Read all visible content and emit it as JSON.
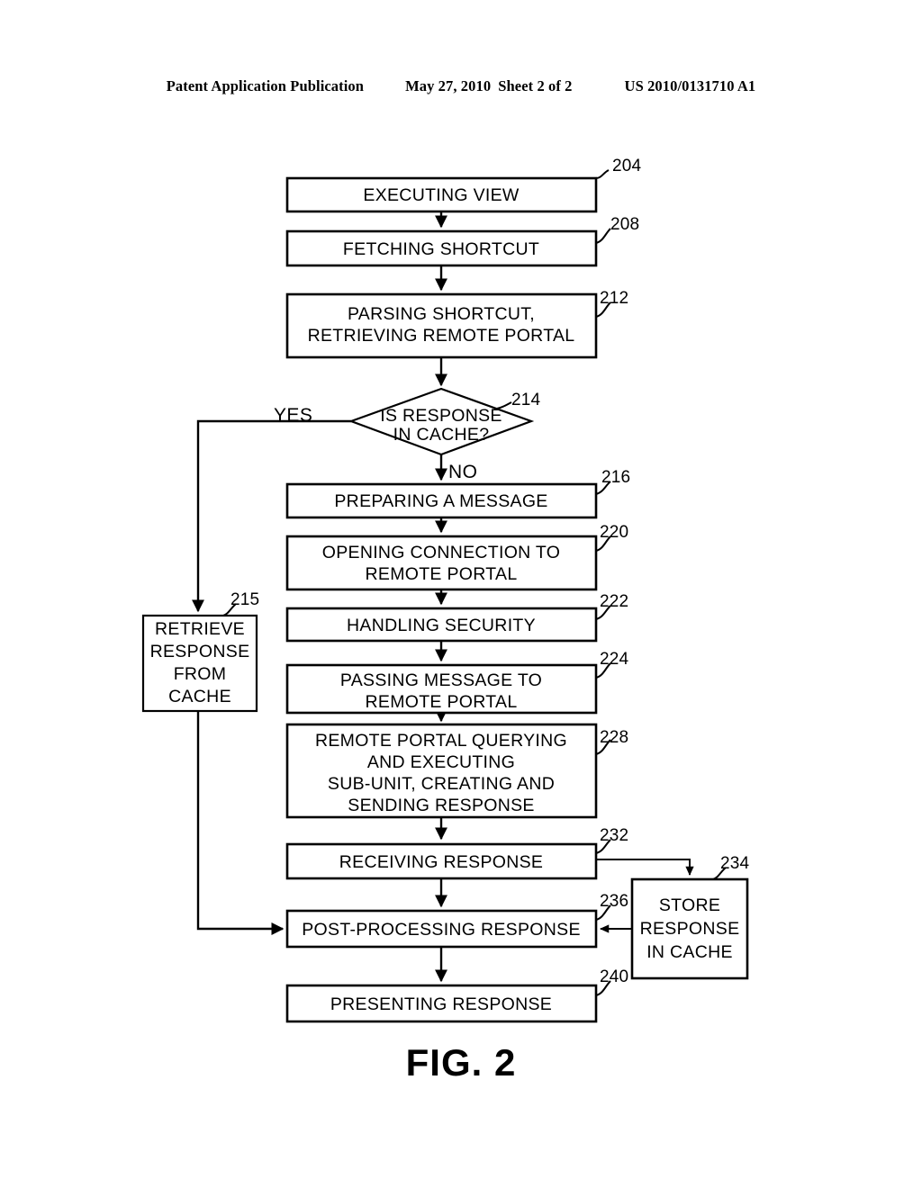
{
  "header": {
    "publication": "Patent Application Publication",
    "date": "May 27, 2010",
    "sheet": "Sheet 2 of 2",
    "number": "US 2010/0131710 A1"
  },
  "figure": {
    "caption": "FIG. 2"
  },
  "diagram": {
    "type": "flowchart",
    "edge_labels": {
      "yes": "YES",
      "no": "NO"
    },
    "nodes": [
      {
        "ref": "204",
        "shape": "process",
        "lines": [
          "EXECUTING VIEW"
        ]
      },
      {
        "ref": "208",
        "shape": "process",
        "lines": [
          "FETCHING SHORTCUT"
        ]
      },
      {
        "ref": "212",
        "shape": "process",
        "lines": [
          "PARSING SHORTCUT,",
          "RETRIEVING REMOTE PORTAL"
        ]
      },
      {
        "ref": "214",
        "shape": "decision",
        "lines": [
          "IS RESPONSE",
          "IN CACHE?"
        ]
      },
      {
        "ref": "215",
        "shape": "process",
        "lines": [
          "RETRIEVE",
          "RESPONSE",
          "FROM",
          "CACHE"
        ]
      },
      {
        "ref": "216",
        "shape": "process",
        "lines": [
          "PREPARING A MESSAGE"
        ]
      },
      {
        "ref": "220",
        "shape": "process",
        "lines": [
          "OPENING CONNECTION TO",
          "REMOTE PORTAL"
        ]
      },
      {
        "ref": "222",
        "shape": "process",
        "lines": [
          "HANDLING SECURITY"
        ]
      },
      {
        "ref": "224",
        "shape": "process",
        "lines": [
          "PASSING MESSAGE TO",
          "REMOTE PORTAL"
        ]
      },
      {
        "ref": "228",
        "shape": "process",
        "lines": [
          "REMOTE PORTAL QUERYING",
          "AND EXECUTING",
          "SUB-UNIT, CREATING AND",
          "SENDING RESPONSE"
        ]
      },
      {
        "ref": "232",
        "shape": "process",
        "lines": [
          "RECEIVING RESPONSE"
        ]
      },
      {
        "ref": "234",
        "shape": "process",
        "lines": [
          "STORE",
          "RESPONSE",
          "IN CACHE"
        ]
      },
      {
        "ref": "236",
        "shape": "process",
        "lines": [
          "POST-PROCESSING RESPONSE"
        ]
      },
      {
        "ref": "240",
        "shape": "process",
        "lines": [
          "PRESENTING RESPONSE"
        ]
      }
    ]
  }
}
